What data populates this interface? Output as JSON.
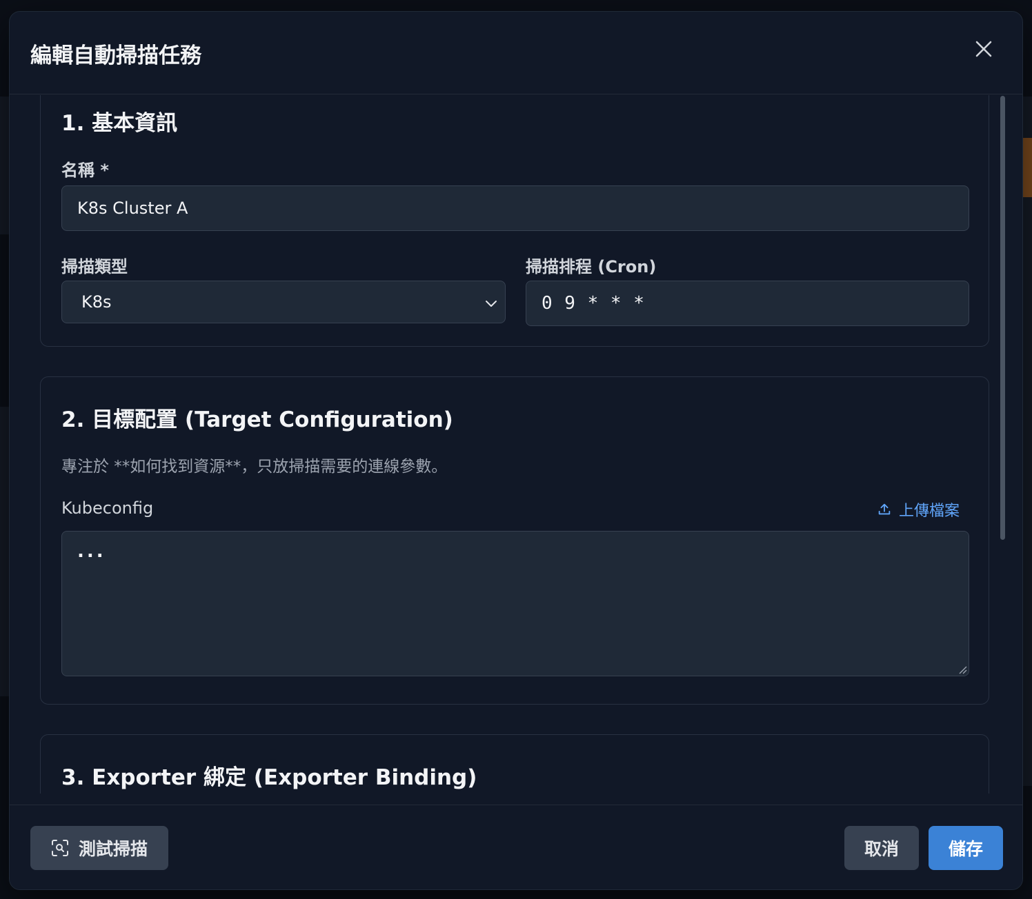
{
  "modal": {
    "title": "編輯自動掃描任務"
  },
  "section1": {
    "title": "1. 基本資訊",
    "name_label": "名稱 *",
    "name_value": "K8s Cluster A",
    "scan_type_label": "掃描類型",
    "scan_type_value": "K8s",
    "schedule_label": "掃描排程 (Cron)",
    "schedule_value": "0 9 * * *"
  },
  "section2": {
    "title": "2. 目標配置 (Target Configuration)",
    "description": "專注於 **如何找到資源**，只放掃描需要的連線參數。",
    "kubeconfig_label": "Kubeconfig",
    "upload_label": "上傳檔案",
    "kubeconfig_value": "..."
  },
  "section3": {
    "title": "3. Exporter 綁定 (Exporter Binding)"
  },
  "footer": {
    "test_label": "測試掃描",
    "cancel_label": "取消",
    "save_label": "儲存"
  },
  "colors": {
    "background": "#111827",
    "input": "#1f2937",
    "accent": "#3b82d6",
    "link": "#60a5fa"
  },
  "icons": [
    "close-icon",
    "chevron-down-icon",
    "upload-icon",
    "scan-search-icon",
    "resize-handle-icon"
  ]
}
